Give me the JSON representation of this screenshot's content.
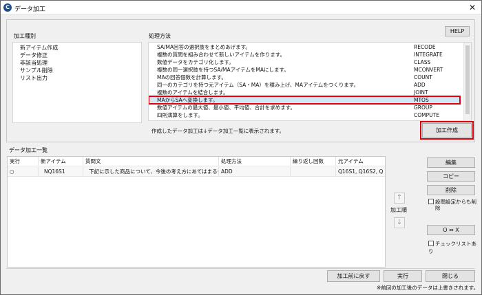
{
  "window": {
    "title": "データ加工",
    "close_glyph": "✕"
  },
  "help_label": "HELP",
  "types_label": "加工種別",
  "types": [
    "新アイテム作成",
    "データ修正",
    "非該当処理",
    "サンプル削除",
    "リスト出力"
  ],
  "methods_label": "処理方法",
  "methods": [
    {
      "desc": "SA/MA回答の選択肢をまとめあげます。",
      "code": "RECODE"
    },
    {
      "desc": "複数の質問を組み合わせて新しいアイテムを作ります。",
      "code": "INTEGRATE"
    },
    {
      "desc": "数値データをカテゴリ化します。",
      "code": "CLASS"
    },
    {
      "desc": "複数の同一選択肢を持つSA/MAアイテムをMAにします。",
      "code": "MCONVERT"
    },
    {
      "desc": "MAの回答個数を計算します。",
      "code": "COUNT"
    },
    {
      "desc": "同一のカテゴリを持つ元アイテム（SA・MA）を積み上げ、MAアイテムをつくります。",
      "code": "ADD"
    },
    {
      "desc": "複数のアイテムを結合します。",
      "code": "JOINT"
    },
    {
      "desc": "MAからSAへ変換します。",
      "code": "MTOS"
    },
    {
      "desc": "数値アイテムの最大値、最小値、平均値、合計を求めます。",
      "code": "GROUP"
    },
    {
      "desc": "四則演算をします。",
      "code": "COMPUTE"
    }
  ],
  "selected_method_index": 7,
  "created_note": "作成したデータ加工は↓データ加工一覧に表示されます。",
  "process_create_label": "加工作成",
  "list_label": "データ加工一覧",
  "grid": {
    "headers": [
      "実行",
      "新アイテム",
      "質問文",
      "処理方法",
      "繰り返し回数",
      "元アイテム"
    ],
    "rows": [
      [
        "○",
        "NQ16S1",
        "下記に示した商品について、今後の考え方にあてはまるもの",
        "ADD",
        "",
        "Q16S1, Q16S2, Q"
      ]
    ]
  },
  "up_arrow": "↑",
  "down_arrow": "↓",
  "order_label": "加工順",
  "side_buttons": {
    "edit": "編集",
    "copy": "コピー",
    "delete": "削除",
    "swap": "O ⇔ X"
  },
  "delete_setting_check": "設問設定からも削除",
  "checklist_check": "チェックリストあり",
  "bottom_buttons": {
    "revert": "加工前に戻す",
    "run": "実行",
    "close": "閉じる"
  },
  "bottom_note": "※前回の加工後のデータは上書きされます。"
}
